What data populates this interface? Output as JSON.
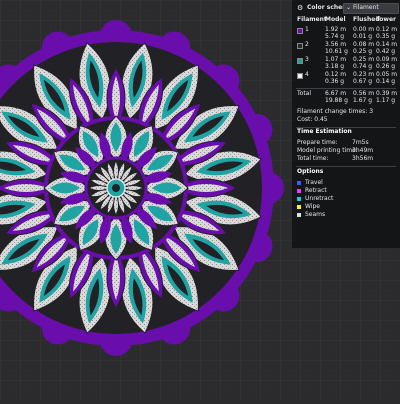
{
  "panel": {
    "header": {
      "icon": "color-scheme-icon",
      "label": "Color scheme",
      "dropdown_value": "Filament"
    },
    "columns": [
      "Filament",
      "Model",
      "Flushed",
      "Tower"
    ],
    "filaments": [
      {
        "id": "1",
        "color": "#6a0dad",
        "model": [
          "1.92 m",
          "5.74 g"
        ],
        "flushed": [
          "0.00 m",
          "0.01 g"
        ],
        "tower": [
          "0.12 m",
          "0.35 g"
        ]
      },
      {
        "id": "2",
        "color": "#2a2a2a",
        "model": [
          "3.56 m",
          "10.61 g"
        ],
        "flushed": [
          "0.08 m",
          "0.25 g"
        ],
        "tower": [
          "0.14 m",
          "0.42 g"
        ]
      },
      {
        "id": "3",
        "color": "#1fa3a3",
        "model": [
          "1.07 m",
          "3.18 g"
        ],
        "flushed": [
          "0.25 m",
          "0.74 g"
        ],
        "tower": [
          "0.09 m",
          "0.26 g"
        ]
      },
      {
        "id": "4",
        "color": "#f2f2f2",
        "model": [
          "0.12 m",
          "0.36 g"
        ],
        "flushed": [
          "0.23 m",
          "0.67 g"
        ],
        "tower": [
          "0.05 m",
          "0.14 g"
        ]
      }
    ],
    "total": {
      "label": "Total",
      "model": [
        "6.67 m",
        "19.88 g"
      ],
      "flushed": [
        "0.56 m",
        "1.67 g"
      ],
      "tower": [
        "0.39 m",
        "1.17 g"
      ]
    },
    "filament_change_times": "Filament change times:  3",
    "cost": "Cost:  0.45",
    "time_section": "Time Estimation",
    "times": [
      {
        "label": "Prepare time:",
        "value": "7m5s"
      },
      {
        "label": "Model printing time:",
        "value": "3h49m"
      },
      {
        "label": "Total time:",
        "value": "3h56m"
      }
    ],
    "options_section": "Options",
    "options": [
      {
        "label": "Travel",
        "color": "#3d5afe"
      },
      {
        "label": "Retract",
        "color": "#e040fb"
      },
      {
        "label": "Unretract",
        "color": "#26c6da"
      },
      {
        "label": "Wipe",
        "color": "#ffeb3b"
      },
      {
        "label": "Seams",
        "color": "#e0e0e0"
      }
    ]
  },
  "viewport": {
    "grid_color": "#3a3a3e",
    "model_colors": {
      "purple": "#6a0dad",
      "teal": "#1fa3a3",
      "white": "#e6e6e6",
      "dark": "#222226"
    }
  }
}
